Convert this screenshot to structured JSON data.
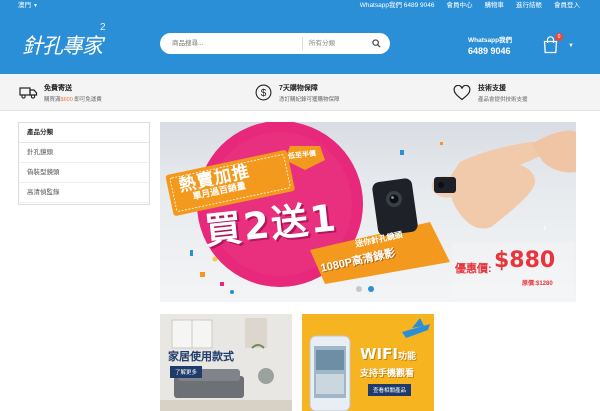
{
  "topbar": {
    "region": "澳門",
    "links": [
      "Whatsapp我們 6489 9046",
      "會員中心",
      "購物車",
      "進行結帳",
      "會員登入"
    ]
  },
  "header": {
    "logo_text": "針孔專家",
    "logo_sup": "2",
    "search_placeholder": "商品搜尋...",
    "search_category": "所有分類",
    "whatsapp_label": "Whatsapp我們",
    "whatsapp_number": "6489 9046",
    "cart_count": "0"
  },
  "features": [
    {
      "icon": "truck-icon",
      "title": "免費寄送",
      "desc_prefix": "購買滿",
      "desc_highlight": "$600",
      "desc_suffix": " 即可免運費"
    },
    {
      "icon": "dollar-circle-icon",
      "title": "7天購物保障",
      "desc_prefix": "憑訂購紀錄可獲購物保障",
      "desc_highlight": "",
      "desc_suffix": ""
    },
    {
      "icon": "heart-icon",
      "title": "技術支援",
      "desc_prefix": "產品會提供技術支援",
      "desc_highlight": "",
      "desc_suffix": ""
    }
  ],
  "sidebar": {
    "heading": "產品分類",
    "items": [
      "針孔鏡頭",
      "偽裝型鏡頭",
      "高清偵監錄"
    ]
  },
  "banner": {
    "badge_line1": "熱賣加推",
    "badge_line2": "單月過百銷量",
    "low_price_tag": "低至半價",
    "main_text": "買2送1",
    "product_line1": "迷你針孔鏡頭",
    "product_line2": "1080P高清錄影",
    "offer_label": "優惠價:",
    "offer_price": "$880",
    "original_price": "原價:$1280",
    "slide_count": 2,
    "active_slide": 1
  },
  "promos": [
    {
      "title": "家居使用款式",
      "button": "了解更多"
    },
    {
      "title_main": "WIFI",
      "title_suffix": "功能",
      "subtitle": "支持手機觀看",
      "button": "查看相關產品"
    }
  ],
  "colors": {
    "brand_blue": "#2b8fd8",
    "accent_orange": "#f39a1e",
    "accent_magenta": "#e8287a",
    "offer_red": "#e8343a"
  }
}
